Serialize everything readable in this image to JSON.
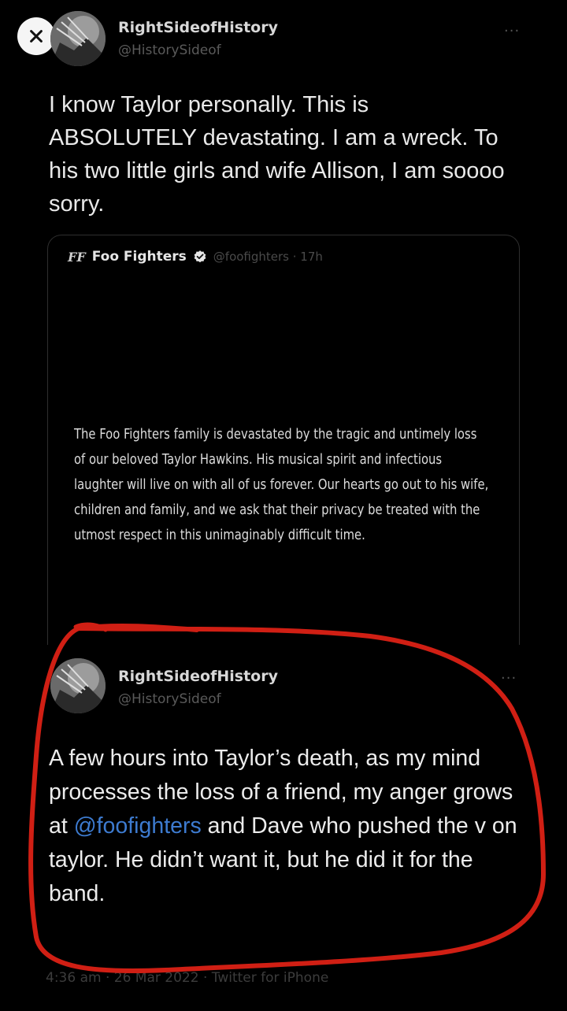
{
  "close": {
    "icon": "close-icon"
  },
  "tweet1": {
    "name": "RightSideofHistory",
    "handle": "@HistorySideof",
    "more": "...",
    "text": "I know Taylor personally. This is ABSOLUTELY devastating. I am a wreck. To his two little girls and wife Allison, I am soooo sorry."
  },
  "quote": {
    "logo": "FF",
    "name": "Foo Fighters",
    "handle": "@foofighters · 17h",
    "text": "The Foo Fighters family is devastated by the tragic and untimely loss of our beloved Taylor Hawkins. His musical spirit and infectious laughter will live on with all of us forever. Our hearts go out to his wife, children and family, and we ask that their privacy be treated with the utmost respect in this unimaginably difficult time."
  },
  "tweet2": {
    "name": "RightSideofHistory",
    "handle": "@HistorySideof",
    "more": "...",
    "text_before": "A few hours into Taylor’s death, as my mind processes the loss of a friend, my anger grows at ",
    "mention": "@foofighters",
    "text_after": " and Dave who pushed the v on taylor. He didn’t want it, but he did it for the band.",
    "footer": "4:36 am · 26 Mar 2022 · Twitter for iPhone"
  },
  "colors": {
    "mention": "#3d7bd0",
    "annotation": "#d01f14",
    "background": "#000000"
  }
}
